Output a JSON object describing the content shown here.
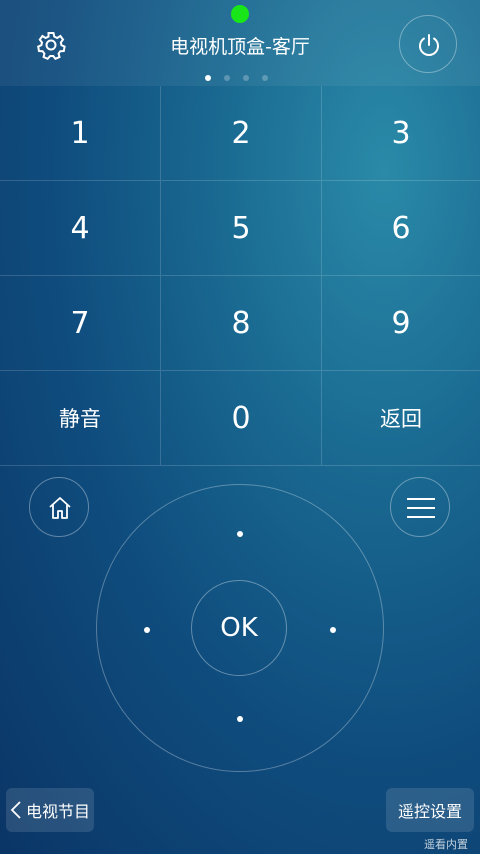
{
  "header": {
    "title": "电视机顶盒-客厅",
    "status_color": "#19e619",
    "page_count": 4,
    "active_page": 1
  },
  "icons": {
    "settings": "gear-icon",
    "power": "power-icon",
    "home": "home-icon",
    "menu": "menu-icon",
    "back": "chevron-left-icon"
  },
  "keypad": {
    "k1": "1",
    "k2": "2",
    "k3": "3",
    "k4": "4",
    "k5": "5",
    "k6": "6",
    "k7": "7",
    "k8": "8",
    "k9": "9",
    "mute": "静音",
    "k0": "0",
    "back": "返回"
  },
  "dpad": {
    "ok_label": "OK"
  },
  "bottom": {
    "program_label": "电视节目",
    "settings_label": "遥控设置",
    "watermark": "遥看内置"
  }
}
